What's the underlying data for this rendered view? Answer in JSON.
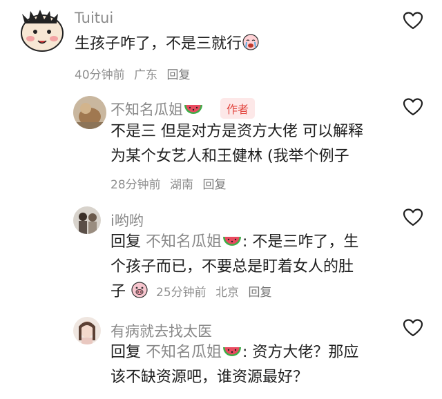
{
  "comments": [
    {
      "username": "Tuitui",
      "text": "生孩子咋了，不是三就行",
      "meta": {
        "time": "40分钟前",
        "location": "广东",
        "reply": "回复"
      }
    },
    {
      "username": "不知名瓜姐",
      "badge": "作者",
      "line1": "不是三 但是对方是资方大佬 可以解释",
      "line2": "为某个女艺人和王健林 (我举个例子",
      "meta": {
        "time": "28分钟前",
        "location": "湖南",
        "reply": "回复"
      }
    },
    {
      "username": "i哟哟",
      "reply_word": "回复",
      "mention": "不知名瓜姐",
      "line1_rest": ": 不是三咋了，生",
      "line2": "个孩子而已，不要总是盯着女人的肚",
      "line3": "子",
      "meta": {
        "time": "25分钟前",
        "location": "北京",
        "reply": "回复"
      }
    },
    {
      "username": "有病就去找太医",
      "reply_word": "回复",
      "mention": "不知名瓜姐",
      "line1_rest": ": 资方大佬？那应",
      "line2": "该不缺资源吧，谁资源最好？",
      "meta": {
        "time": "",
        "location": "",
        "reply": ""
      }
    }
  ],
  "icons": {
    "like": "heart-outline-icon",
    "watermelon": "watermelon-emoji-icon",
    "crying": "crying-face-emoji-icon",
    "pig": "pig-face-emoji-icon"
  },
  "colors": {
    "text": "#1f1f1f",
    "username": "#8a8a8a",
    "meta": "#8f8f8f",
    "badge_bg": "#fde8e8",
    "badge_text": "#e2463f"
  }
}
